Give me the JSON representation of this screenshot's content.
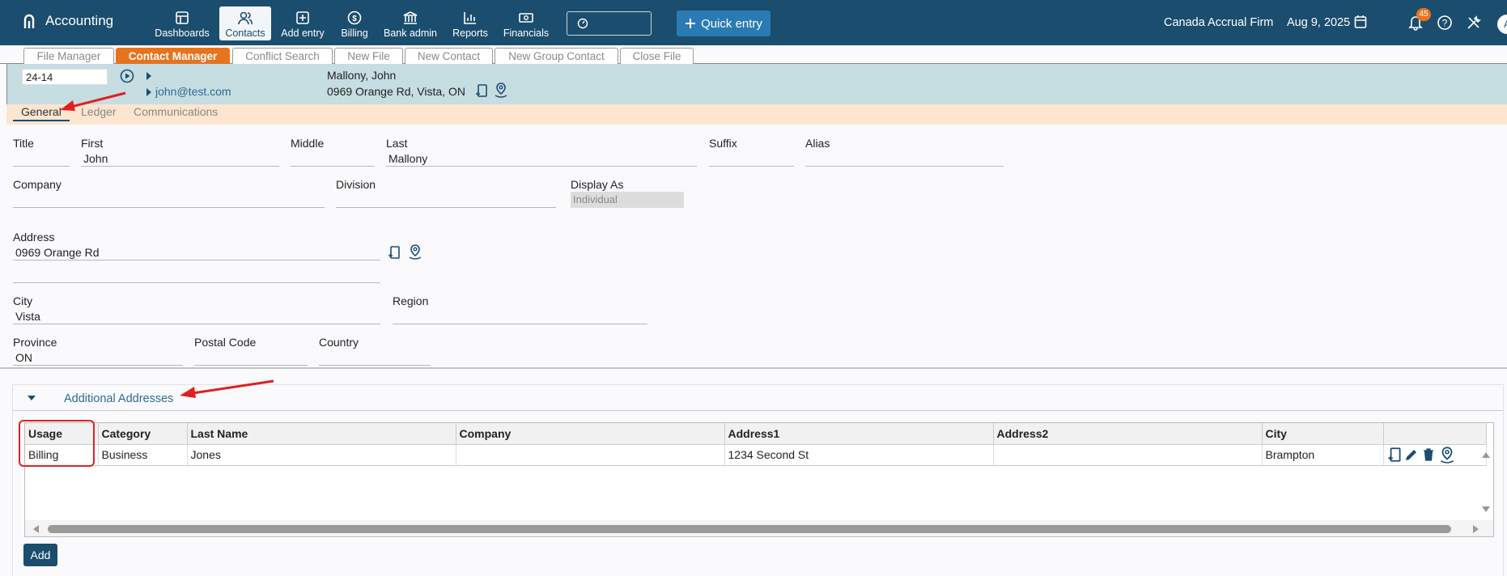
{
  "app": {
    "name": "Accounting"
  },
  "nav": {
    "items": [
      {
        "label": "Dashboards",
        "icon": "dashboard-icon"
      },
      {
        "label": "Contacts",
        "icon": "contacts-icon"
      },
      {
        "label": "Add entry",
        "icon": "add-entry-icon"
      },
      {
        "label": "Billing",
        "icon": "billing-icon"
      },
      {
        "label": "Bank admin",
        "icon": "bank-icon"
      },
      {
        "label": "Reports",
        "icon": "reports-icon"
      },
      {
        "label": "Financials",
        "icon": "financials-icon"
      }
    ],
    "active": "Contacts",
    "quick_entry": "Quick entry",
    "firm": "Canada Accrual Firm",
    "date": "Aug 9, 2025",
    "notifications": "45"
  },
  "file_tabs": [
    "File Manager",
    "Contact Manager",
    "Conflict Search",
    "New File",
    "New Contact",
    "New Group Contact",
    "Close File"
  ],
  "header": {
    "file_number": "24-14",
    "email": "john@test.com",
    "name": "Mallony, John",
    "address": "0969 Orange Rd, Vista, ON"
  },
  "sub_tabs": [
    "General",
    "Ledger",
    "Communications"
  ],
  "form": {
    "title_label": "Title",
    "title_value": "",
    "first_label": "First",
    "first_value": "John",
    "middle_label": "Middle",
    "middle_value": "",
    "last_label": "Last",
    "last_value": "Mallony",
    "suffix_label": "Suffix",
    "suffix_value": "",
    "alias_label": "Alias",
    "alias_value": "",
    "company_label": "Company",
    "company_value": "",
    "division_label": "Division",
    "division_value": "",
    "display_as_label": "Display As",
    "display_as_value": "Individual",
    "address_label": "Address",
    "address_value": "0969 Orange Rd",
    "address2_value": "",
    "city_label": "City",
    "city_value": "Vista",
    "region_label": "Region",
    "region_value": "",
    "province_label": "Province",
    "province_value": "ON",
    "postal_label": "Postal Code",
    "postal_value": "",
    "country_label": "Country",
    "country_value": ""
  },
  "additional_addresses": {
    "title": "Additional Addresses",
    "columns": [
      "Usage",
      "Category",
      "Last Name",
      "Company",
      "Address1",
      "Address2",
      "City"
    ],
    "rows": [
      [
        "Billing",
        "Business",
        "Jones",
        "",
        "1234 Second St",
        "",
        "Brampton"
      ]
    ],
    "add_label": "Add"
  },
  "colors": {
    "nav_bg": "#1b4d6e",
    "accent": "#e8731d",
    "header_band": "#c6dde2",
    "subtab_band": "#fde5d0",
    "annotation": "#e02020"
  }
}
